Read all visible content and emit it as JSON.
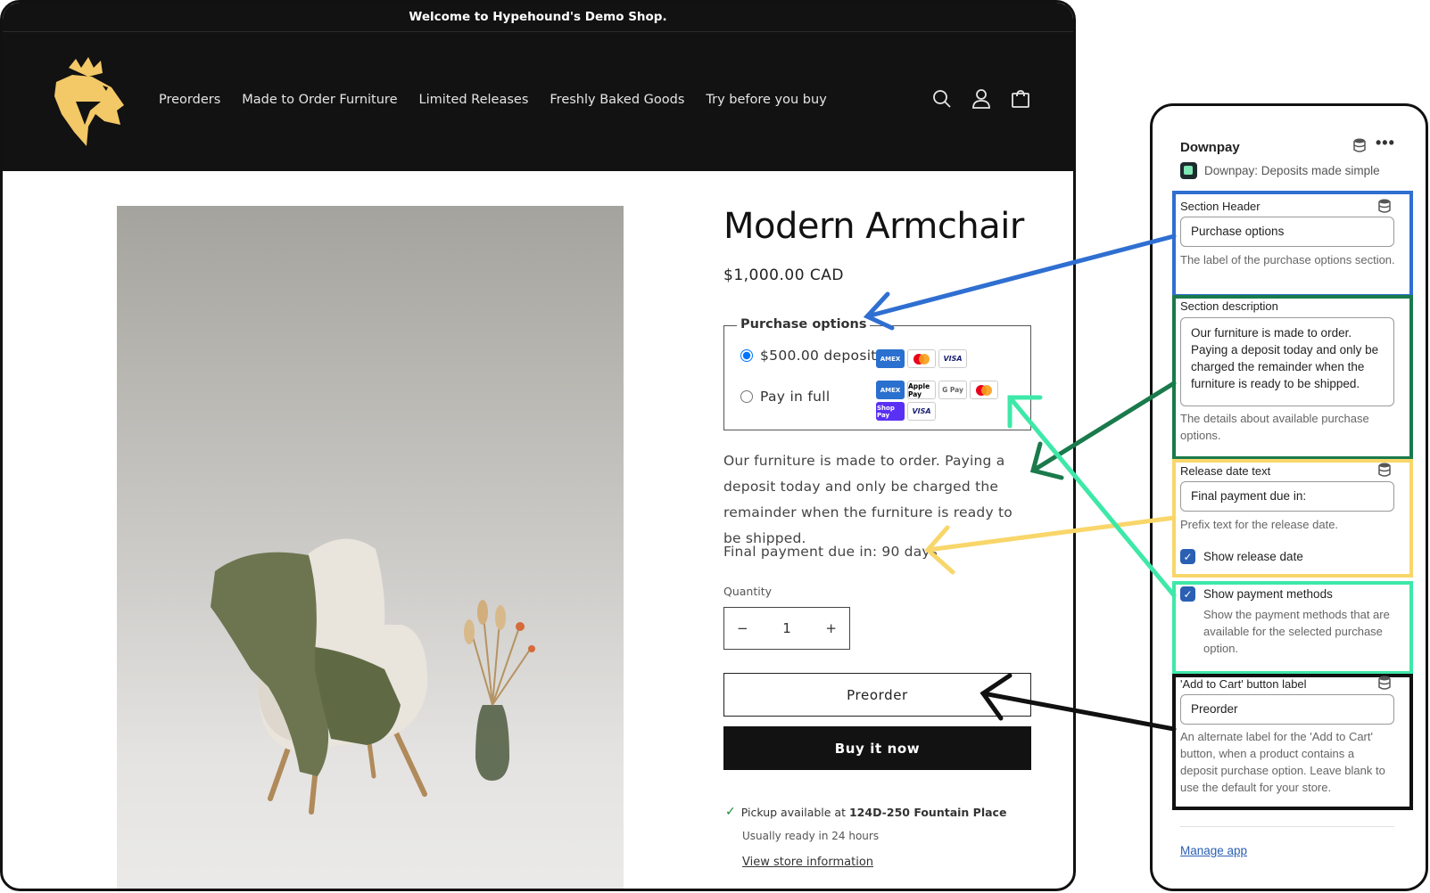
{
  "store": {
    "announcement": "Welcome to Hypehound's Demo Shop.",
    "nav": [
      "Preorders",
      "Made to Order Furniture",
      "Limited Releases",
      "Freshly Baked Goods",
      "Try before you buy"
    ],
    "icons": [
      "search-icon",
      "account-icon",
      "cart-icon"
    ],
    "product": {
      "title": "Modern Armchair",
      "price": "$1,000.00 CAD",
      "purchase_options_label": "Purchase options",
      "options": [
        {
          "label": "$500.00 deposit",
          "selected": true,
          "payment_methods": [
            "AMEX",
            "Mastercard",
            "VISA"
          ]
        },
        {
          "label": "Pay in full",
          "selected": false,
          "payment_methods": [
            "AMEX",
            "Apple Pay",
            "G Pay",
            "Mastercard",
            "Shop Pay",
            "VISA"
          ]
        }
      ],
      "description": "Our furniture is made to order. Paying a deposit today and only be charged the remainder when the furniture is ready to be shipped.",
      "release_text": "Final payment due in: 90 days",
      "quantity_label": "Quantity",
      "quantity": "1",
      "decrement": "−",
      "increment": "+",
      "preorder_label": "Preorder",
      "buy_now_label": "Buy it now",
      "pickup_prefix": "Pickup available at",
      "pickup_location": "124D-250 Fountain Place",
      "pickup_ready": "Usually ready in 24 hours",
      "store_info_link": "View store information"
    }
  },
  "panel": {
    "title": "Downpay",
    "more": "•••",
    "app_name": "Downpay: Deposits made simple",
    "section_header": {
      "label": "Section Header",
      "value": "Purchase options",
      "help": "The label of the purchase options section."
    },
    "section_description": {
      "label": "Section description",
      "value": "Our furniture is made to order. Paying a deposit today and only be charged the remainder when the furniture is ready to be shipped.",
      "help": "The details about available purchase options."
    },
    "release_date": {
      "label": "Release date text",
      "value": "Final payment due in:",
      "help": "Prefix text for the release date.",
      "show_label": "Show release date",
      "show_checked": true
    },
    "payment_methods": {
      "label": "Show payment methods",
      "checked": true,
      "help": "Show the payment methods that are available for the selected purchase option."
    },
    "cart_label": {
      "label": "'Add to Cart' button label",
      "value": "Preorder",
      "help": "An alternate label for the 'Add to Cart' button, when a product contains a deposit purchase option. Leave blank to use the default for your store."
    },
    "manage_link": "Manage app"
  },
  "annotation_colors": {
    "blue": "#2f6fd1",
    "green": "#1a7a4c",
    "yellow": "#f8d66a",
    "teal": "#3ee8a8",
    "black": "#111111"
  }
}
